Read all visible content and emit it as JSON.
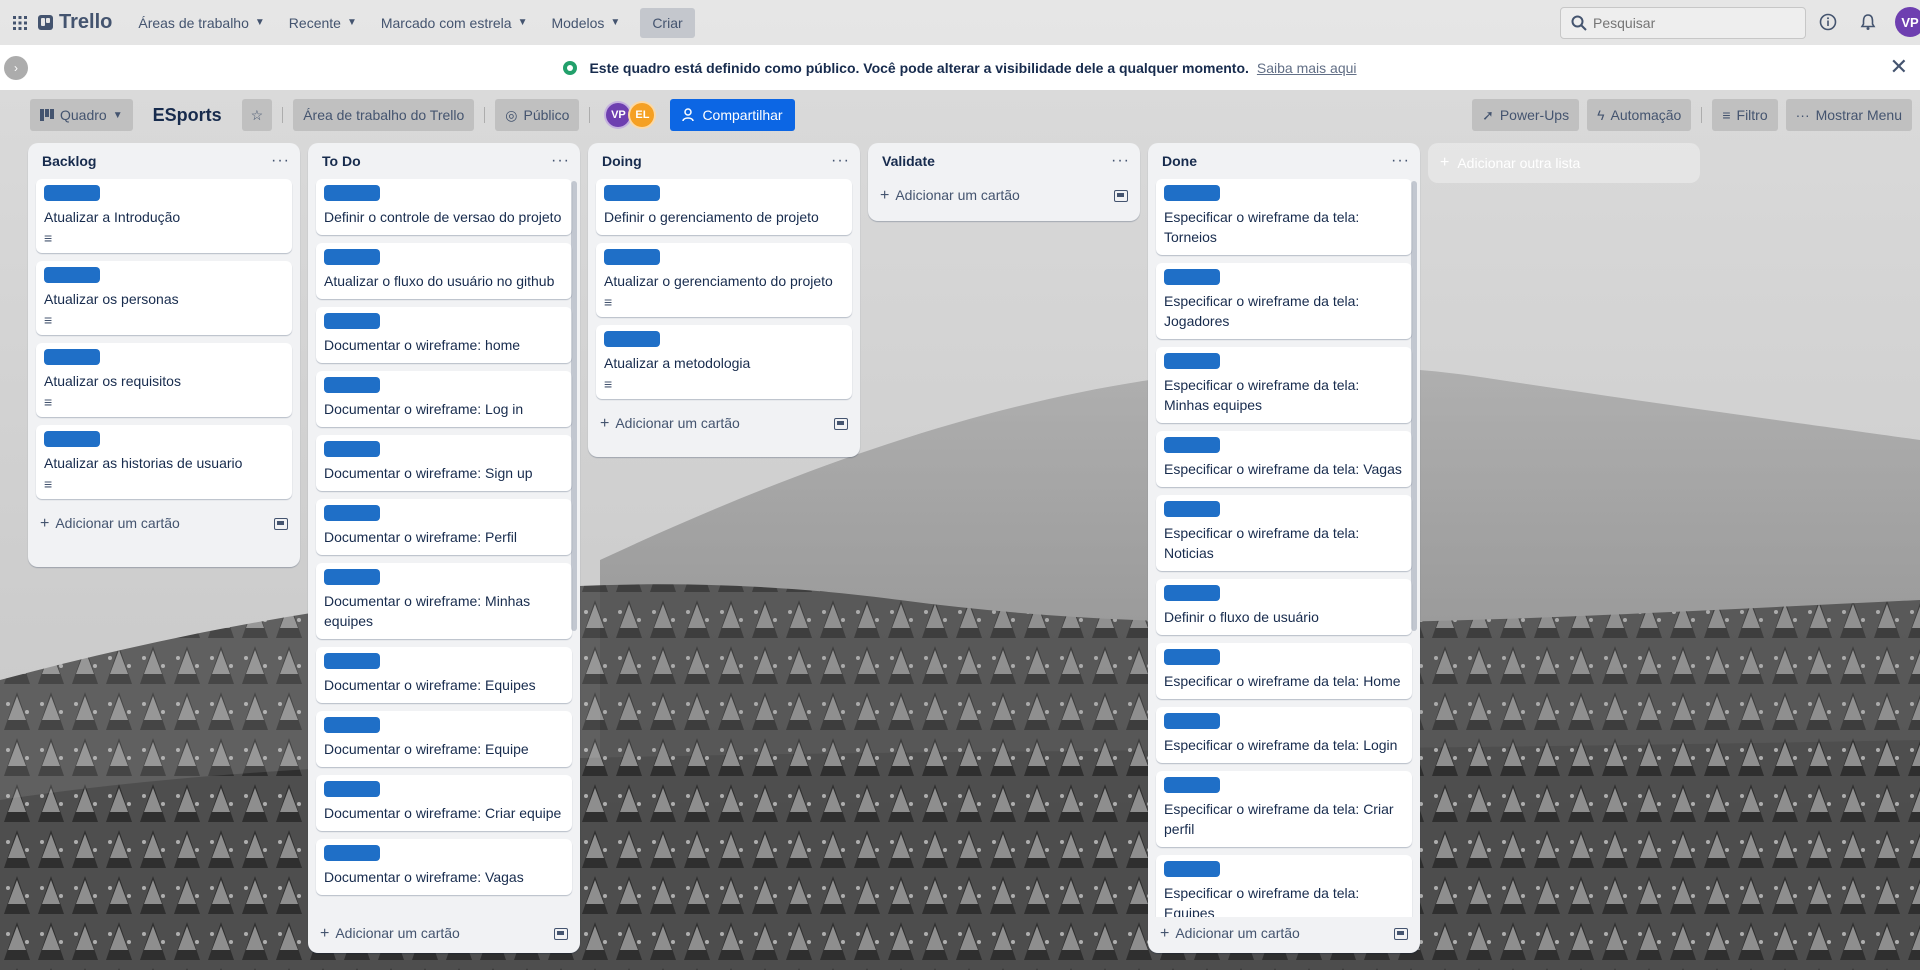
{
  "topnav": {
    "logo": "Trello",
    "menus": [
      "Áreas de trabalho",
      "Recente",
      "Marcado com estrela",
      "Modelos"
    ],
    "create": "Criar",
    "search_placeholder": "Pesquisar",
    "avatar": "VP"
  },
  "banner": {
    "text": "Este quadro está definido como público. Você pode alterar a visibilidade dele a qualquer momento.",
    "link": "Saiba mais aqui"
  },
  "board": {
    "view": "Quadro",
    "title": "ESports",
    "workspace": "Área de trabalho do Trello",
    "visibility": "Público",
    "members": [
      "VP",
      "EL"
    ],
    "share": "Compartilhar",
    "powerups": "Power-Ups",
    "automation": "Automação",
    "filter": "Filtro",
    "menu": "Mostrar Menu"
  },
  "add_card_label": "Adicionar um cartão",
  "add_list_label": "Adicionar outra lista",
  "lists": [
    {
      "title": "Backlog",
      "cards": [
        {
          "title": "Atualizar a Introdução",
          "desc": true
        },
        {
          "title": "Atualizar os personas",
          "desc": true
        },
        {
          "title": "Atualizar os requisitos",
          "desc": true
        },
        {
          "title": "Atualizar as historias de usuario",
          "desc": true
        }
      ]
    },
    {
      "title": "To Do",
      "cards": [
        {
          "title": "Definir o controle de versao do projeto",
          "desc": false
        },
        {
          "title": "Atualizar o fluxo do usuário no github",
          "desc": false
        },
        {
          "title": "Documentar o wireframe: home",
          "desc": false
        },
        {
          "title": "Documentar o wireframe: Log in",
          "desc": false
        },
        {
          "title": "Documentar o wireframe: Sign up",
          "desc": false
        },
        {
          "title": "Documentar o wireframe: Perfil",
          "desc": false
        },
        {
          "title": "Documentar o wireframe: Minhas equipes",
          "desc": false
        },
        {
          "title": "Documentar o wireframe: Equipes",
          "desc": false
        },
        {
          "title": "Documentar o wireframe: Equipe",
          "desc": false
        },
        {
          "title": "Documentar o wireframe: Criar equipe",
          "desc": false
        },
        {
          "title": "Documentar o wireframe: Vagas",
          "desc": false
        }
      ]
    },
    {
      "title": "Doing",
      "cards": [
        {
          "title": "Definir o gerenciamento de projeto",
          "desc": false
        },
        {
          "title": "Atualizar o gerenciamento do projeto",
          "desc": true
        },
        {
          "title": "Atualizar a metodologia",
          "desc": true
        }
      ]
    },
    {
      "title": "Validate",
      "cards": []
    },
    {
      "title": "Done",
      "cards": [
        {
          "title": "Especificar o wireframe da tela: Torneios",
          "desc": false
        },
        {
          "title": "Especificar o wireframe da tela: Jogadores",
          "desc": false
        },
        {
          "title": "Especificar o wireframe da tela: Minhas equipes",
          "desc": false
        },
        {
          "title": "Especificar o wireframe da tela: Vagas",
          "desc": false
        },
        {
          "title": "Especificar o wireframe da tela: Noticias",
          "desc": false
        },
        {
          "title": "Definir o fluxo de usuário",
          "desc": false
        },
        {
          "title": "Especificar o wireframe da tela: Home",
          "desc": false
        },
        {
          "title": "Especificar o wireframe da tela: Login",
          "desc": false
        },
        {
          "title": "Especificar o wireframe da tela: Criar perfil",
          "desc": false
        },
        {
          "title": "Especificar o wireframe da tela: Equipes",
          "desc": false
        }
      ]
    }
  ],
  "colors": {
    "label_blue": "#1f6fc7",
    "share_blue": "#0c66e4",
    "avatar_vp": "#6e3fb0",
    "avatar_el": "#f5a023"
  }
}
